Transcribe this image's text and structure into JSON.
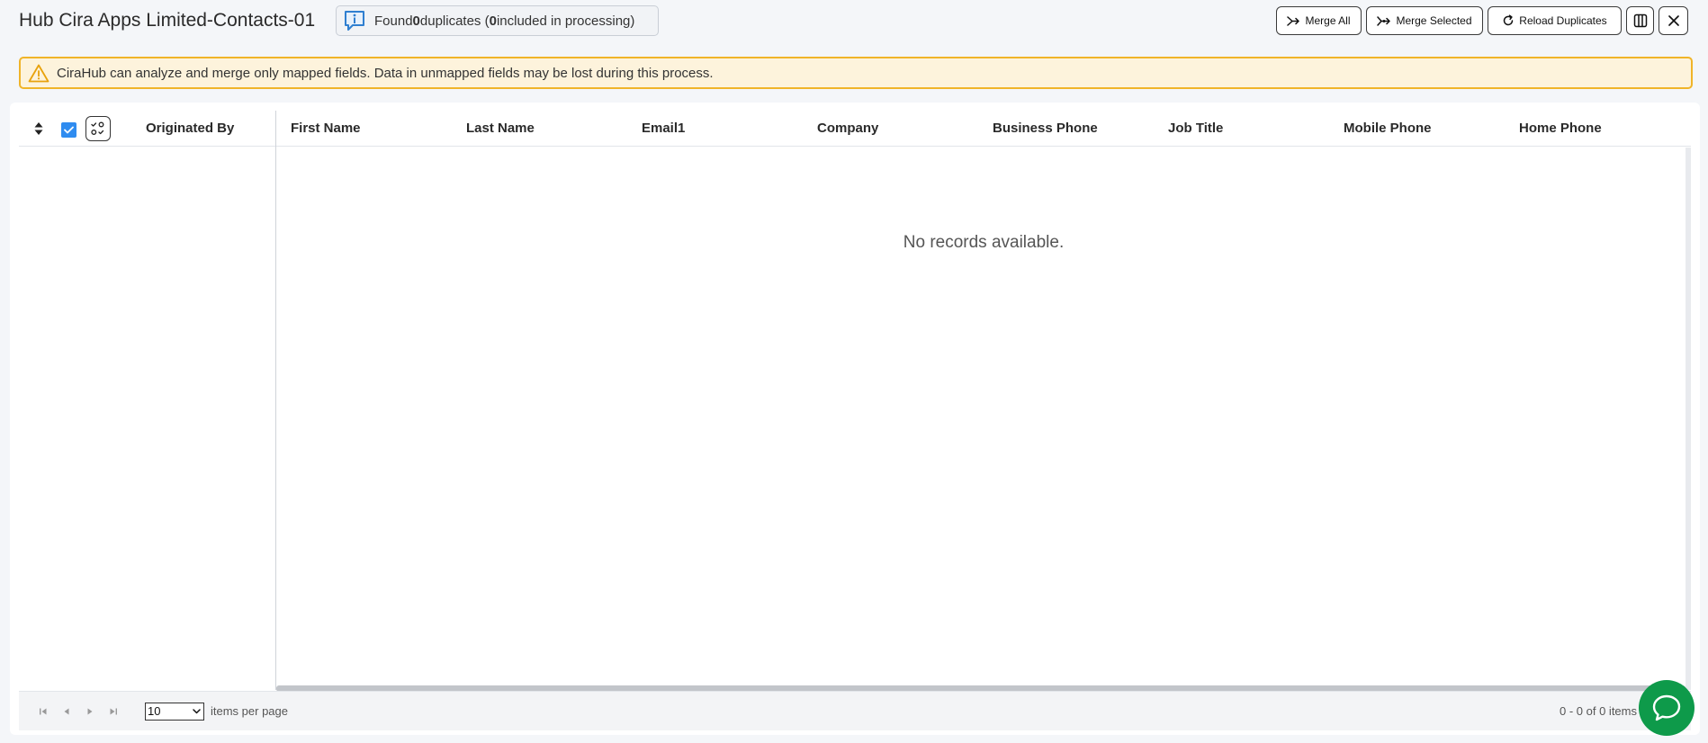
{
  "header": {
    "title": "Hub Cira Apps Limited-Contacts-01",
    "info": {
      "prefix": "Found ",
      "found_count": "0",
      "middle": " duplicates (",
      "included_count": "0",
      "suffix": " included in processing)"
    }
  },
  "toolbar": {
    "merge_all_label": "Merge All",
    "merge_selected_label": "Merge Selected",
    "reload_label": "Reload Duplicates",
    "columns_icon": "columns-icon",
    "close_icon": "close-icon"
  },
  "warning": {
    "text": "CiraHub can analyze and merge only mapped fields. Data in unmapped fields may be lost during this process.",
    "icon": "warning-icon"
  },
  "grid": {
    "locked_columns": [
      "Originated By"
    ],
    "columns": [
      "First Name",
      "Last Name",
      "Email1",
      "Company",
      "Business Phone",
      "Job Title",
      "Mobile Phone",
      "Home Phone"
    ],
    "header_checkbox_checked": true,
    "empty_message": "No records available."
  },
  "pager": {
    "page_size": "10",
    "items_per_page_label": "items per page",
    "range_text": "0 - 0 of 0 items"
  },
  "colors": {
    "accent": "#2f8cf0",
    "warning_border": "#f0b429",
    "warning_bg": "#fdf3dc",
    "chat": "#0e9a4a"
  }
}
